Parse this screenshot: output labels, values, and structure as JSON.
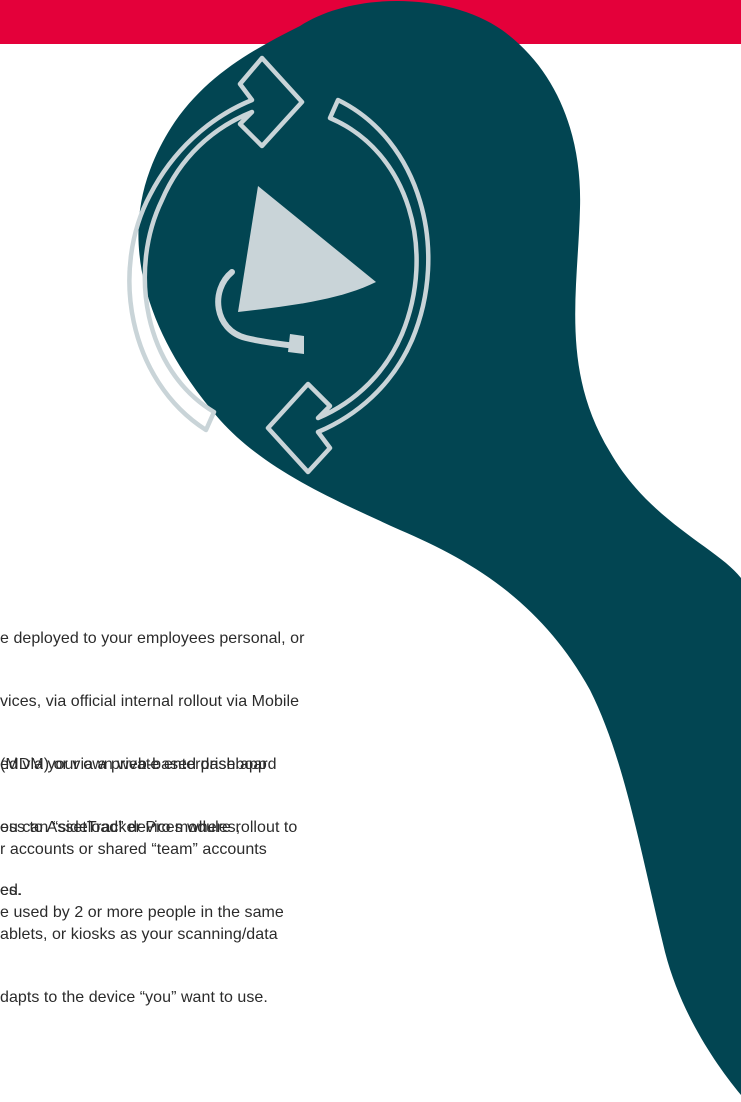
{
  "colors": {
    "banner": "#e4003a",
    "teal": "#024552",
    "icon": "#c9d4d8",
    "text": "#2b2b2b"
  },
  "icon": {
    "name": "refresh-cycle-with-cup-icon"
  },
  "paragraphs": [
    {
      "lines": [
        "e deployed to your employees personal, or",
        "vices, via official internal rollout via Mobile",
        "(MDM) or via a private enterprise app",
        "ou can “sideload” devices where rollout to",
        "ed."
      ]
    },
    {
      "lines": [
        "ed via your own web-based dashboard",
        "ess to AssetTracker Pro modules,",
        "es."
      ]
    },
    {
      "lines": [
        "r accounts or shared “team” accounts",
        "e used by 2 or more people in the same"
      ]
    },
    {
      "lines": [
        "ablets, or kiosks as your scanning/data",
        "dapts to the device “you” want to use."
      ]
    }
  ]
}
